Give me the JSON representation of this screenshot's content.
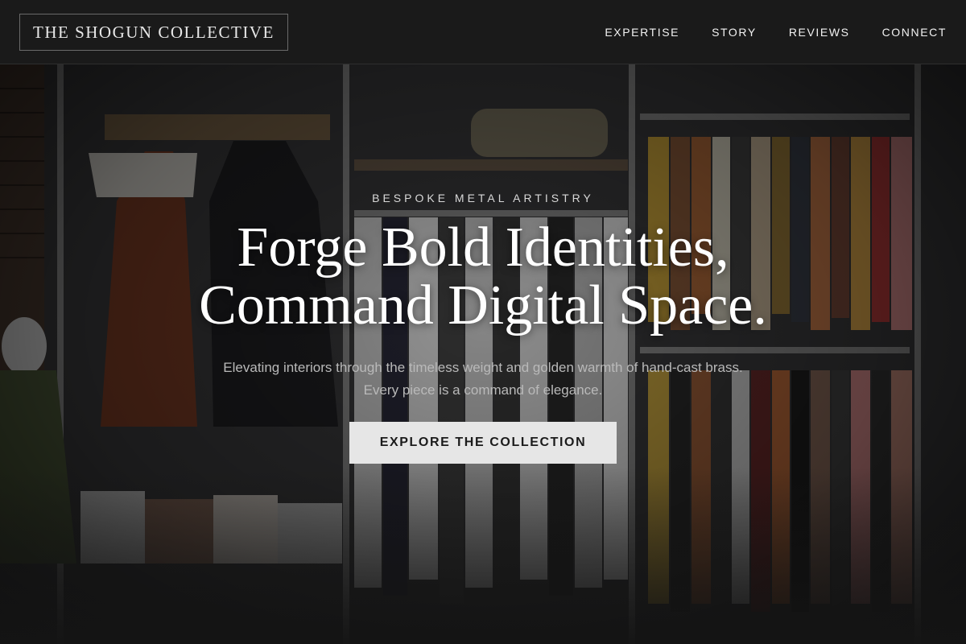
{
  "brand": {
    "name": "THE SHOGUN COLLECTIVE"
  },
  "nav": {
    "items": [
      {
        "label": "EXPERTISE"
      },
      {
        "label": "STORY"
      },
      {
        "label": "REVIEWS"
      },
      {
        "label": "CONNECT"
      }
    ]
  },
  "hero": {
    "eyebrow": "BESPOKE METAL ARTISTRY",
    "headline_line1": "Forge Bold Identities,",
    "headline_line2": "Command Digital Space.",
    "subtitle": "Elevating interiors through the timeless weight and golden warmth of hand-cast brass. Every piece is a command of elegance.",
    "cta_label": "EXPLORE THE COLLECTION"
  },
  "colors": {
    "nav_background": "#1a1a1a",
    "button_background": "#e6e6e6",
    "button_text": "#1b1b1b",
    "headline": "#ffffff"
  }
}
